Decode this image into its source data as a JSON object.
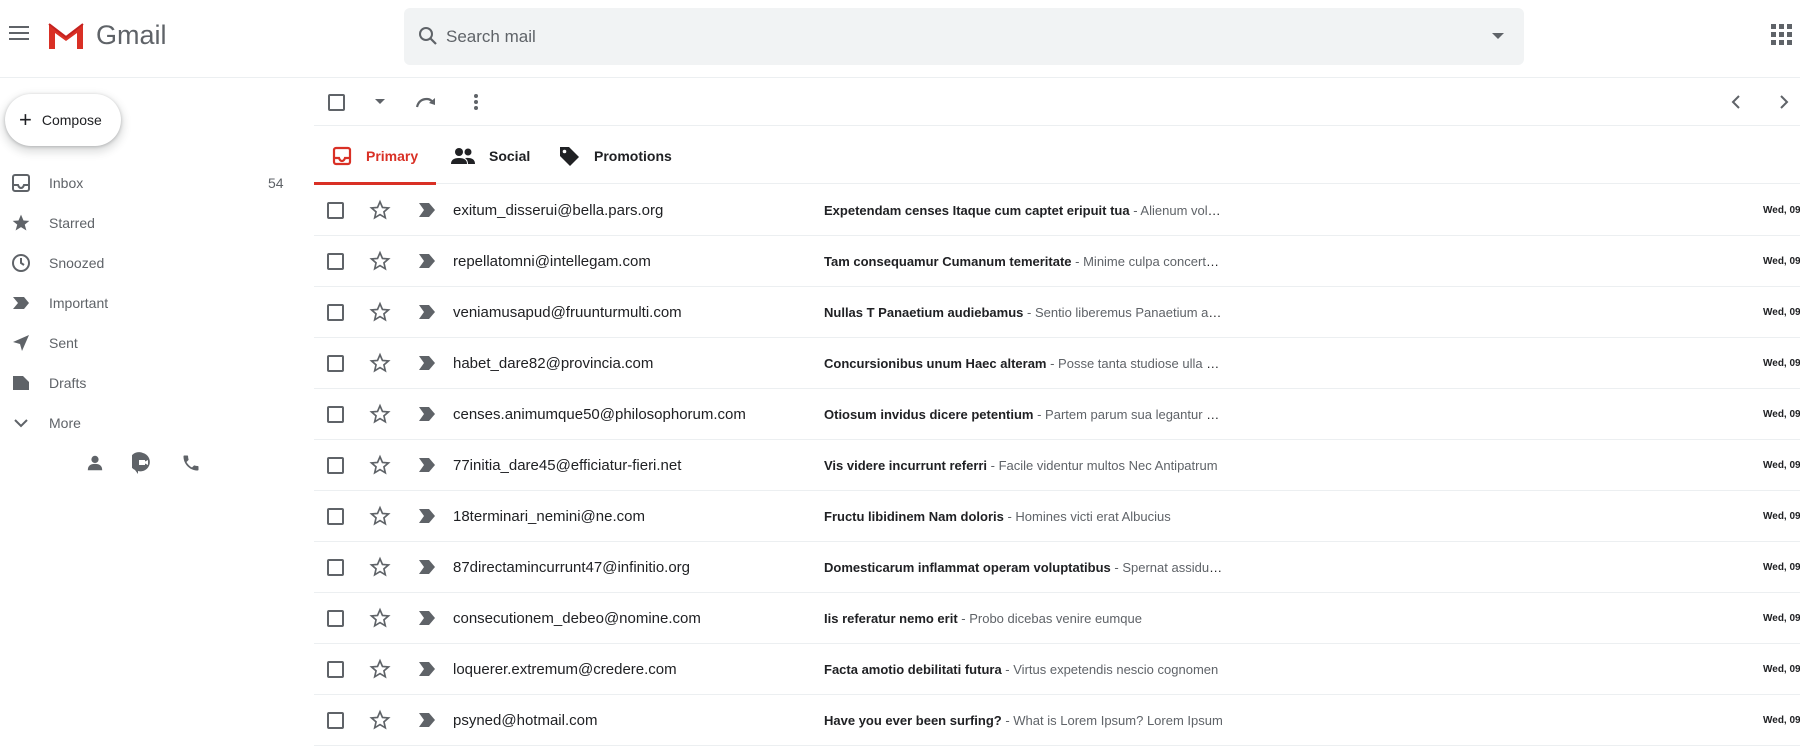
{
  "header": {
    "logo_text": "Gmail",
    "search_placeholder": "Search mail"
  },
  "compose": {
    "label": "Compose"
  },
  "sidebar": {
    "items": [
      {
        "label": "Inbox",
        "count": "54",
        "icon": "inbox-icon"
      },
      {
        "label": "Starred",
        "count": "",
        "icon": "star-icon"
      },
      {
        "label": "Snoozed",
        "count": "",
        "icon": "clock-icon"
      },
      {
        "label": "Important",
        "count": "",
        "icon": "important-icon"
      },
      {
        "label": "Sent",
        "count": "",
        "icon": "send-icon"
      },
      {
        "label": "Drafts",
        "count": "",
        "icon": "draft-icon"
      },
      {
        "label": "More",
        "count": "",
        "icon": "chevron-down-icon"
      }
    ]
  },
  "tabs": [
    {
      "label": "Primary",
      "icon": "inbox-tab-icon",
      "active": true
    },
    {
      "label": "Social",
      "icon": "people-icon",
      "active": false
    },
    {
      "label": "Promotions",
      "icon": "tag-icon",
      "active": false
    }
  ],
  "emails": [
    {
      "sender": "exitum_disserui@bella.pars.org",
      "subject": "Expetendam censes Itaque cum captet eripuit tua",
      "preview": " - Alienum volunt",
      "date": "Wed, 09"
    },
    {
      "sender": "repellatomni@intellegam.com",
      "subject": "Tam consequamur Cumanum temeritate",
      "preview": " - Minime culpa concertationesque",
      "date": "Wed, 09"
    },
    {
      "sender": "veniamusapud@fruunturmulti.com",
      "subject": "Nullas T Panaetium audiebamus",
      "preview": " - Sentio liberemus Panaetium animos",
      "date": "Wed, 09"
    },
    {
      "sender": "habet_dare82@provincia.com",
      "subject": "Concursionibus unum Haec alteram",
      "preview": " - Posse tanta studiose ulla oratio",
      "date": "Wed, 09"
    },
    {
      "sender": "censes.animumque50@philosophorum.com",
      "subject": "Otiosum invidus dicere petentium",
      "preview": " - Partem parum sua legantur eius",
      "date": "Wed, 09"
    },
    {
      "sender": "77initia_dare45@efficiatur-fieri.net",
      "subject": "Vis videre incurrunt referri",
      "preview": " - Facile videntur multos Nec Antipatrum",
      "date": "Wed, 09"
    },
    {
      "sender": "18terminari_nemini@ne.com",
      "subject": "Fructu libidinem Nam doloris",
      "preview": " - Homines victi erat Albucius",
      "date": "Wed, 09"
    },
    {
      "sender": "87directamincurrunt47@infinitio.org",
      "subject": "Domesticarum inflammat operam voluptatibus",
      "preview": " - Spernat assiduitas",
      "date": "Wed, 09"
    },
    {
      "sender": "consecutionem_debeo@nomine.com",
      "subject": "Iis referatur nemo erit",
      "preview": " - Probo dicebas venire eumque",
      "date": "Wed, 09"
    },
    {
      "sender": "loquerer.extremum@credere.com",
      "subject": "Facta amotio debilitati futura",
      "preview": " - Virtus expetendis nescio cognomen",
      "date": "Wed, 09"
    },
    {
      "sender": "psyned@hotmail.com",
      "subject": "Have you ever been surfing?",
      "preview": " - What is Lorem Ipsum? Lorem Ipsum",
      "date": "Wed, 09"
    }
  ],
  "colors": {
    "accent": "#d93025",
    "icon": "#5f6368"
  }
}
